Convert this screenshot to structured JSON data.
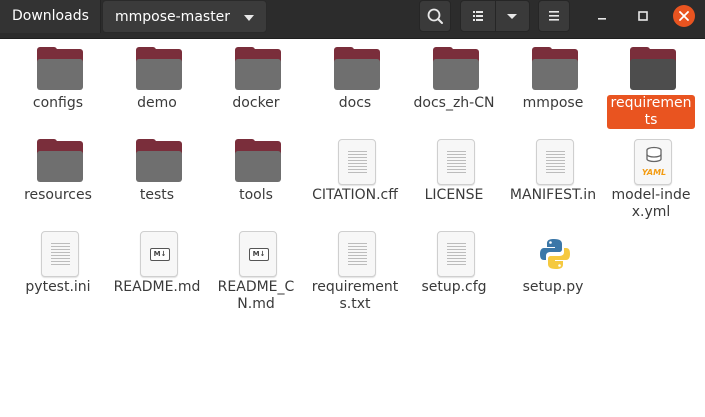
{
  "breadcrumb": {
    "root_label": "Downloads",
    "current_label": "mmpose-master"
  },
  "toolbar": {
    "search_icon": "search-icon",
    "view_icon": "list-view-icon",
    "view_options_icon": "chevron-down-icon",
    "menu_icon": "hamburger-menu-icon"
  },
  "window": {
    "minimize_icon": "minimize-icon",
    "maximize_icon": "maximize-icon",
    "close_icon": "close-icon",
    "close_color": "#e95420"
  },
  "accent_color": "#e95420",
  "files": [
    {
      "name": "configs",
      "type": "folder"
    },
    {
      "name": "demo",
      "type": "folder"
    },
    {
      "name": "docker",
      "type": "folder"
    },
    {
      "name": "docs",
      "type": "folder"
    },
    {
      "name": "docs_zh-CN",
      "type": "folder"
    },
    {
      "name": "mmpose",
      "type": "folder"
    },
    {
      "name": "requirements",
      "type": "folder",
      "selected": true
    },
    {
      "name": "resources",
      "type": "folder"
    },
    {
      "name": "tests",
      "type": "folder"
    },
    {
      "name": "tools",
      "type": "folder"
    },
    {
      "name": "CITATION.cff",
      "type": "text"
    },
    {
      "name": "LICENSE",
      "type": "text"
    },
    {
      "name": "MANIFEST.in",
      "type": "text"
    },
    {
      "name": "model-index.yml",
      "type": "yaml"
    },
    {
      "name": "pytest.ini",
      "type": "text"
    },
    {
      "name": "README.md",
      "type": "markdown"
    },
    {
      "name": "README_CN.md",
      "type": "markdown"
    },
    {
      "name": "requirements.txt",
      "type": "text"
    },
    {
      "name": "setup.cfg",
      "type": "text"
    },
    {
      "name": "setup.py",
      "type": "python"
    }
  ]
}
